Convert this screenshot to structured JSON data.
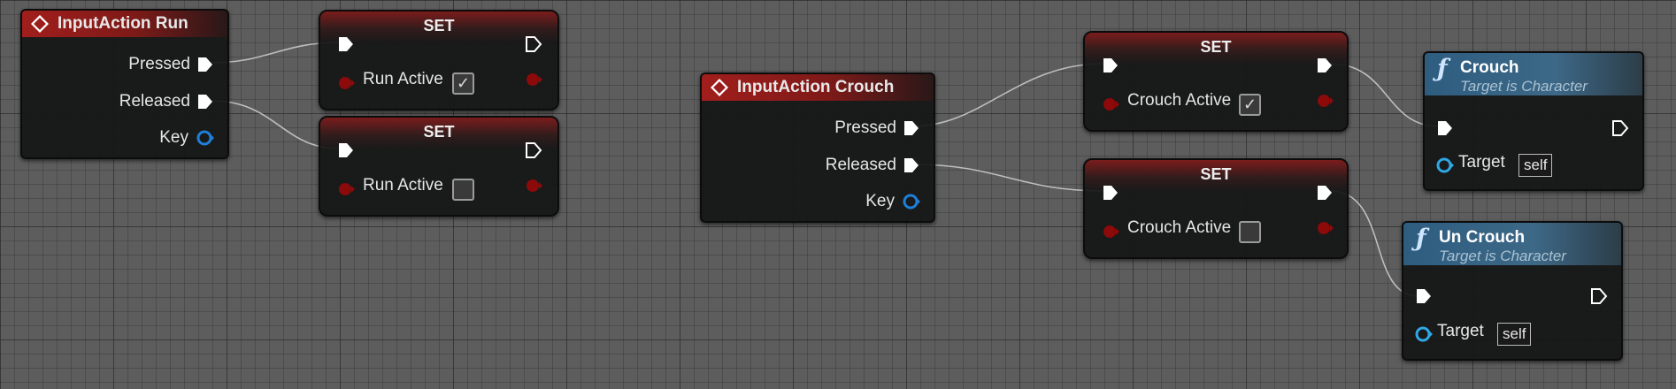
{
  "events": [
    {
      "title": "InputAction Run",
      "pins": [
        "Pressed",
        "Released",
        "Key"
      ]
    },
    {
      "title": "InputAction Crouch",
      "pins": [
        "Pressed",
        "Released",
        "Key"
      ]
    }
  ],
  "set_nodes": [
    {
      "title": "SET",
      "variable": "Run Active",
      "checked": true
    },
    {
      "title": "SET",
      "variable": "Run Active",
      "checked": false
    },
    {
      "title": "SET",
      "variable": "Crouch Active",
      "checked": true
    },
    {
      "title": "SET",
      "variable": "Crouch Active",
      "checked": false
    }
  ],
  "functions": [
    {
      "name": "Crouch",
      "subtitle": "Target is Character",
      "target_label": "Target",
      "target_value": "self"
    },
    {
      "name": "Un Crouch",
      "subtitle": "Target is Character",
      "target_label": "Target",
      "target_value": "self"
    }
  ],
  "checkmark_glyph": "✓",
  "colors": {
    "exec": "#ffffff",
    "bool_pin": "#8c0a0a",
    "key_pin": "#1e7fd9",
    "target_pin": "#2fa8e6",
    "event_header": "#a11e1c",
    "function_header": "#3d6887",
    "wire": "#cfcfcf"
  }
}
